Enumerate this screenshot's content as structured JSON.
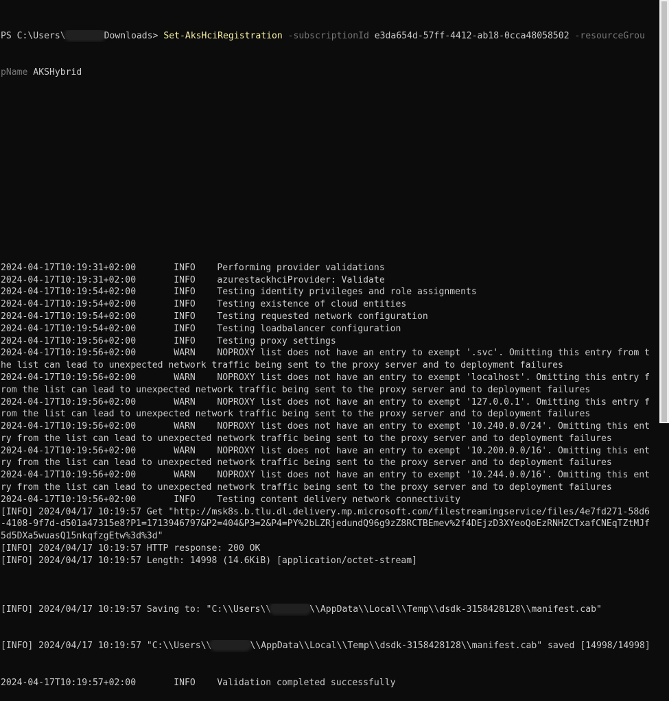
{
  "prompt": {
    "ps_prefix": "PS C:\\Users\\",
    "path_suffix": "Downloads> ",
    "command": "Set-AksHciRegistration",
    "param1": " -subscriptionId ",
    "subscription_id": "e3da654d-57ff-4412-ab18-0cca48058502",
    "param2": " -resourceGrou",
    "param2_wrap": "pName",
    "resource_group": " AKSHybrid"
  },
  "log": [
    "2024-04-17T10:19:31+02:00       INFO    Performing provider validations",
    "2024-04-17T10:19:31+02:00       INFO    azurestackhciProvider: Validate",
    "2024-04-17T10:19:54+02:00       INFO    Testing identity privileges and role assignments",
    "2024-04-17T10:19:54+02:00       INFO    Testing existence of cloud entities",
    "2024-04-17T10:19:54+02:00       INFO    Testing requested network configuration",
    "2024-04-17T10:19:54+02:00       INFO    Testing loadbalancer configuration",
    "2024-04-17T10:19:56+02:00       INFO    Testing proxy settings",
    "2024-04-17T10:19:56+02:00       WARN    NOPROXY list does not have an entry to exempt '.svc'. Omitting this entry from t",
    "he list can lead to unexpected network traffic being sent to the proxy server and to deployment failures",
    "2024-04-17T10:19:56+02:00       WARN    NOPROXY list does not have an entry to exempt 'localhost'. Omitting this entry f",
    "rom the list can lead to unexpected network traffic being sent to the proxy server and to deployment failures",
    "2024-04-17T10:19:56+02:00       WARN    NOPROXY list does not have an entry to exempt '127.0.0.1'. Omitting this entry f",
    "rom the list can lead to unexpected network traffic being sent to the proxy server and to deployment failures",
    "2024-04-17T10:19:56+02:00       WARN    NOPROXY list does not have an entry to exempt '10.240.0.0/24'. Omitting this ent",
    "ry from the list can lead to unexpected network traffic being sent to the proxy server and to deployment failures",
    "2024-04-17T10:19:56+02:00       WARN    NOPROXY list does not have an entry to exempt '10.200.0.0/16'. Omitting this ent",
    "ry from the list can lead to unexpected network traffic being sent to the proxy server and to deployment failures",
    "2024-04-17T10:19:56+02:00       WARN    NOPROXY list does not have an entry to exempt '10.244.0.0/16'. Omitting this ent",
    "ry from the list can lead to unexpected network traffic being sent to the proxy server and to deployment failures",
    "2024-04-17T10:19:56+02:00       INFO    Testing content delivery network connectivity",
    "[INFO] 2024/04/17 10:19:57 Get \"http://msk8s.b.tlu.dl.delivery.mp.microsoft.com/filestreamingservice/files/4e7fd271-58d6",
    "-4108-9f7d-d501a47315e8?P1=1713946797&P2=404&P3=2&P4=PY%2bLZRjedundQ96g9zZ8RCTBEmev%2f4DEjzD3XYeoQoEzRNHZCTxafCNEqTZtMJf",
    "5d5DXa5wuasQ15nkqfzgEtw%3d%3d\"",
    "[INFO] 2024/04/17 10:19:57 HTTP response: 200 OK",
    "[INFO] 2024/04/17 10:19:57 Length: 14998 (14.6KiB) [application/octet-stream]"
  ],
  "saving_line": {
    "before": "[INFO] 2024/04/17 10:19:57 Saving to: \"C:\\\\Users\\\\",
    "after": "\\\\AppData\\\\Local\\\\Temp\\\\dsdk-3158428128\\\\manifest.cab\""
  },
  "saved_line": {
    "before": "[INFO] 2024/04/17 10:19:57 \"C:\\\\Users\\\\",
    "after": "\\\\AppData\\\\Local\\\\Temp\\\\dsdk-3158428128\\\\manifest.cab\" saved [14998/14998]"
  },
  "final_line": "2024-04-17T10:19:57+02:00       INFO    Validation completed successfully",
  "colors": {
    "background": "#0c0c0c",
    "text": "#cccccc",
    "command": "#f9f1a5",
    "parameter": "#767676"
  }
}
